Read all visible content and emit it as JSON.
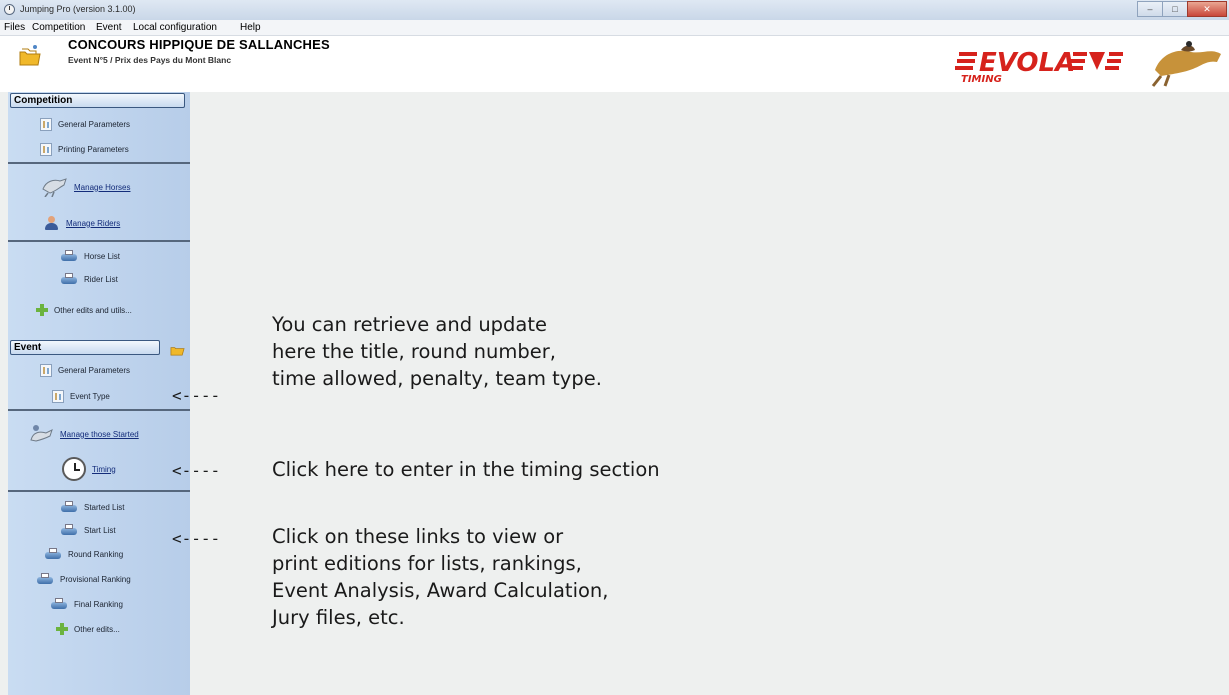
{
  "window": {
    "title": "Jumping Pro (version 3.1.00)",
    "controls": [
      "minimize",
      "maximize",
      "close"
    ]
  },
  "menubar": {
    "items": [
      "Files",
      "Competition",
      "Event",
      "Local configuration",
      "Help"
    ]
  },
  "header": {
    "title": "CONCOURS HIPPIQUE DE SALLANCHES",
    "subtitle": "Event N°5 / Prix des Pays du Mont Blanc",
    "logo_text": "EVOLA",
    "logo_sub": "TIMING",
    "colors": {
      "logo_red": "#d6221c",
      "logo_gold": "#d8a43a"
    }
  },
  "sidebar": {
    "competition": {
      "header": "Competition",
      "items": [
        {
          "label": "General Parameters",
          "icon": "parameters-icon"
        },
        {
          "label": "Printing Parameters",
          "icon": "parameters-icon"
        },
        {
          "label": "Manage Horses",
          "icon": "horse-icon"
        },
        {
          "label": "Manage Riders",
          "icon": "rider-icon"
        },
        {
          "label": "Horse List",
          "icon": "printer-icon"
        },
        {
          "label": "Rider List",
          "icon": "printer-icon"
        },
        {
          "label": "Other edits and utils...",
          "icon": "plus-icon"
        }
      ]
    },
    "event": {
      "header": "Event",
      "items": [
        {
          "label": "General Parameters",
          "icon": "parameters-icon"
        },
        {
          "label": "Event Type",
          "icon": "parameters-icon"
        },
        {
          "label": "Manage those Started",
          "icon": "horse-rider-icon"
        },
        {
          "label": "Timing",
          "icon": "clock-icon"
        },
        {
          "label": "Started List",
          "icon": "printer-icon"
        },
        {
          "label": "Start List",
          "icon": "printer-icon"
        },
        {
          "label": "Round Ranking",
          "icon": "printer-icon"
        },
        {
          "label": "Provisional Ranking",
          "icon": "printer-icon"
        },
        {
          "label": "Final Ranking",
          "icon": "printer-icon"
        },
        {
          "label": "Other edits...",
          "icon": "plus-icon"
        }
      ]
    },
    "colors": {
      "panel": "#c4d8ef",
      "divider": "#56677d"
    }
  },
  "annotations": {
    "arrow": "<----",
    "note1": [
      "You can retrieve and update",
      "here the title, round number,",
      "time allowed, penalty, team type."
    ],
    "note2": [
      "Click here to enter in the timing section"
    ],
    "note3": [
      "Click on these links to view or",
      "print editions for lists, rankings,",
      "Event Analysis, Award Calculation,",
      "Jury files, etc."
    ]
  }
}
